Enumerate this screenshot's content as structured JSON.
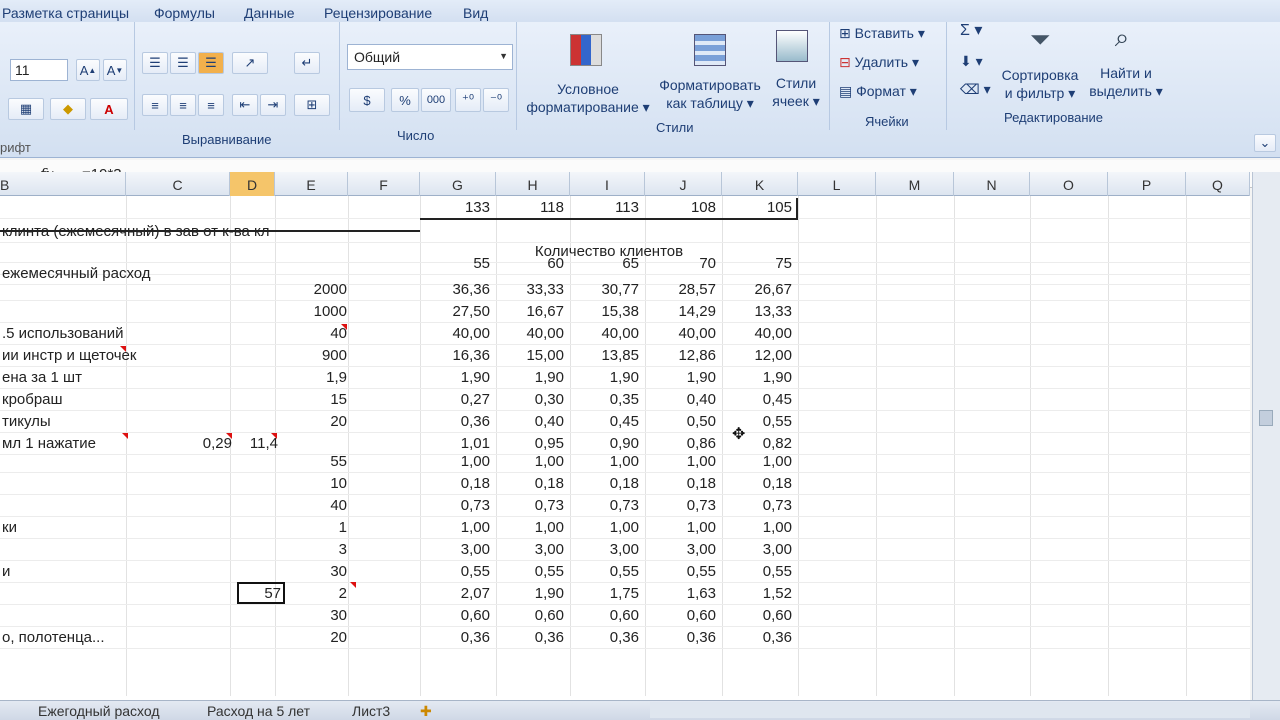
{
  "ribbon": {
    "tabs": [
      "Разметка страницы",
      "Формулы",
      "Данные",
      "Рецензирование",
      "Вид"
    ],
    "font_size": "11",
    "groups": {
      "font": "рифт",
      "align": "Выравнивание",
      "number": "Число",
      "styles": "Стили",
      "cells": "Ячейки",
      "edit": "Редактирование"
    },
    "number_format": "Общий",
    "cond_format": [
      "Условное",
      "форматирование ▾"
    ],
    "format_table": [
      "Форматировать",
      "как таблицу ▾"
    ],
    "cell_styles": [
      "Стили",
      "ячеек ▾"
    ],
    "insert": "Вставить ▾",
    "delete": "Удалить ▾",
    "format": "Формат ▾",
    "sort": [
      "Сортировка",
      "и фильтр ▾"
    ],
    "find": [
      "Найти и",
      "выделить ▾"
    ],
    "percent": "%",
    "thousands": "000"
  },
  "formula": {
    "fx": "fx",
    "value": "=19*3"
  },
  "columns": [
    "B",
    "C",
    "D",
    "E",
    "F",
    "G",
    "H",
    "I",
    "J",
    "K",
    "L",
    "M",
    "N",
    "O",
    "P",
    "Q"
  ],
  "rows": [
    {
      "label": "",
      "e": "",
      "vals": [
        "133",
        "118",
        "113",
        "108",
        "105"
      ]
    },
    {
      "label": "клинта (ежемесячный) в зав от к-ва кл",
      "e": "",
      "vals": [
        "",
        "",
        "",
        "",
        ""
      ]
    },
    {
      "label": "",
      "e": "",
      "vals": [
        "Количество клиентов"
      ]
    },
    {
      "label": "",
      "e": "",
      "vals": [
        "55",
        "60",
        "65",
        "70",
        "75"
      ]
    },
    {
      "label": "ежемесячный расход",
      "e": "",
      "vals": [
        "",
        "",
        "",
        "",
        ""
      ]
    },
    {
      "label": "",
      "e": "2000",
      "vals": [
        "36,36",
        "33,33",
        "30,77",
        "28,57",
        "26,67"
      ]
    },
    {
      "label": "",
      "e": "1000",
      "vals": [
        "27,50",
        "16,67",
        "15,38",
        "14,29",
        "13,33"
      ]
    },
    {
      "label": ".5 использований",
      "e": "40",
      "vals": [
        "40,00",
        "40,00",
        "40,00",
        "40,00",
        "40,00"
      ]
    },
    {
      "label": "ии инстр и щеточек",
      "e": "900",
      "vals": [
        "16,36",
        "15,00",
        "13,85",
        "12,86",
        "12,00"
      ]
    },
    {
      "label": "ена за 1 шт",
      "e": "1,9",
      "vals": [
        "1,90",
        "1,90",
        "1,90",
        "1,90",
        "1,90"
      ]
    },
    {
      "label": "кробраш",
      "e": "15",
      "vals": [
        "0,27",
        "0,30",
        "0,35",
        "0,40",
        "0,45"
      ]
    },
    {
      "label": "тикулы",
      "e": "20",
      "vals": [
        "0,36",
        "0,40",
        "0,45",
        "0,50",
        "0,55"
      ]
    },
    {
      "label": "мл 1 нажатие",
      "c": "0,29",
      "d": "11,4",
      "e": "",
      "vals": [
        "1,01",
        "0,95",
        "0,90",
        "0,86",
        "0,82"
      ]
    },
    {
      "label": "",
      "e": "55",
      "vals": [
        "1,00",
        "1,00",
        "1,00",
        "1,00",
        "1,00"
      ]
    },
    {
      "label": "",
      "e": "10",
      "vals": [
        "0,18",
        "0,18",
        "0,18",
        "0,18",
        "0,18"
      ]
    },
    {
      "label": "",
      "e": "40",
      "vals": [
        "0,73",
        "0,73",
        "0,73",
        "0,73",
        "0,73"
      ]
    },
    {
      "label": "ки",
      "e": "1",
      "vals": [
        "1,00",
        "1,00",
        "1,00",
        "1,00",
        "1,00"
      ]
    },
    {
      "label": "",
      "e": "3",
      "vals": [
        "3,00",
        "3,00",
        "3,00",
        "3,00",
        "3,00"
      ]
    },
    {
      "label": "и",
      "e": "30",
      "vals": [
        "0,55",
        "0,55",
        "0,55",
        "0,55",
        "0,55"
      ]
    },
    {
      "label": "",
      "d": "57",
      "e": "2",
      "vals": [
        "2,07",
        "1,90",
        "1,75",
        "1,63",
        "1,52"
      ]
    },
    {
      "label": "",
      "e": "30",
      "vals": [
        "0,60",
        "0,60",
        "0,60",
        "0,60",
        "0,60"
      ]
    },
    {
      "label": "о, полотенца...",
      "e": "20",
      "vals": [
        "0,36",
        "0,36",
        "0,36",
        "0,36",
        "0,36"
      ]
    }
  ],
  "sheets": [
    "Ежегодный расход",
    "Расход на 5 лет",
    "Лист3"
  ]
}
